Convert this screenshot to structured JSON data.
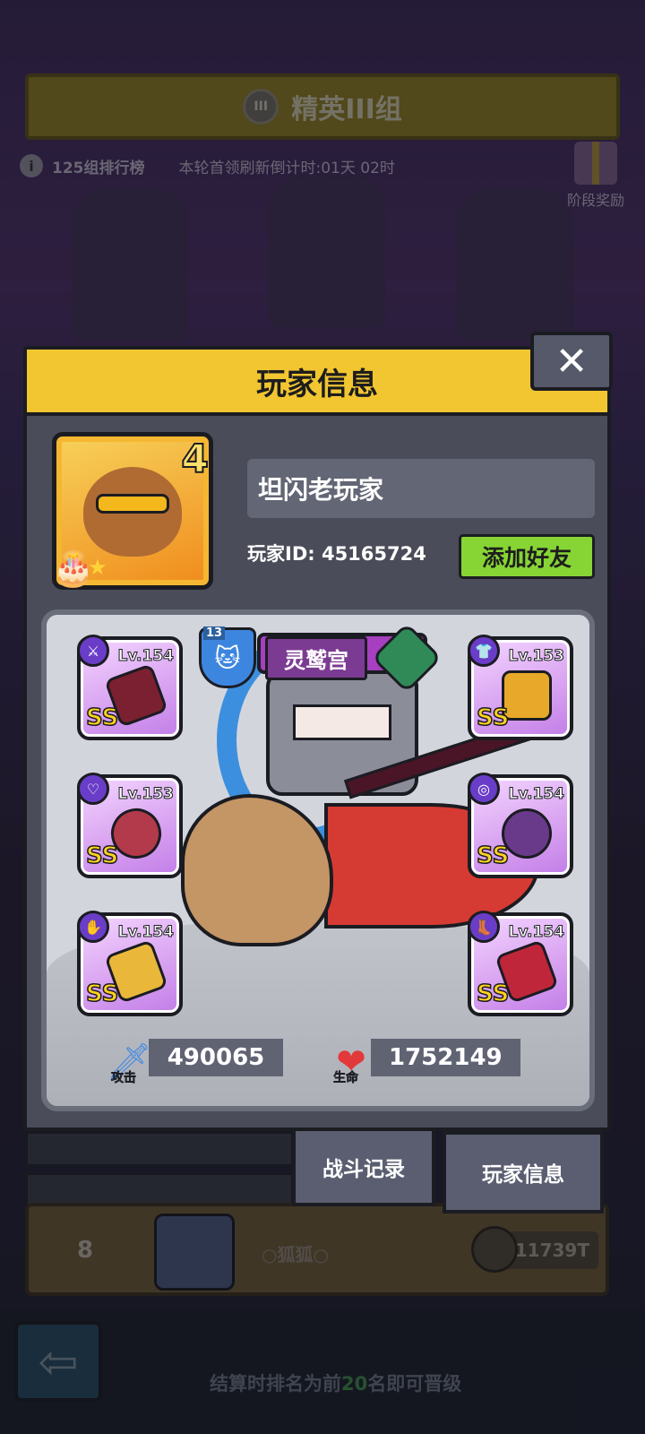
{
  "background": {
    "banner_title": "精英III组",
    "rank_label": "125组排行榜",
    "refresh_text": "本轮首领刷新倒计时:01天 02时",
    "stage_reward": "阶段奖励",
    "emblem_text": "III"
  },
  "dialog": {
    "title": "玩家信息",
    "close": "✕",
    "avatar_level": "4",
    "player_name": "坦闪老玩家",
    "player_id": "玩家ID: 45165724",
    "add_friend": "添加好友",
    "guild": {
      "level": "13",
      "name": "灵鹫宫"
    },
    "equipment": [
      {
        "lv": "Lv.154",
        "grade": "SS",
        "type_icon": "⚔"
      },
      {
        "lv": "Lv.153",
        "grade": "SS",
        "type_icon": "♡"
      },
      {
        "lv": "Lv.154",
        "grade": "SS",
        "type_icon": "✋"
      },
      {
        "lv": "Lv.153",
        "grade": "SS",
        "type_icon": "👕"
      },
      {
        "lv": "Lv.154",
        "grade": "SS",
        "type_icon": "◎"
      },
      {
        "lv": "Lv.154",
        "grade": "SS",
        "type_icon": "👢"
      }
    ],
    "stats": {
      "attack_label": "攻击",
      "attack_value": "490065",
      "hp_label": "生命",
      "hp_value": "1752149"
    }
  },
  "tabs": {
    "battle_record": "战斗记录",
    "player_info": "玩家信息"
  },
  "ranking_row": {
    "rank": "8",
    "name": "○狐狐○",
    "power": "11739T"
  },
  "footer": {
    "promo_prefix": "结算时排名为前",
    "promo_number": "20",
    "promo_suffix": "名即可晋级"
  },
  "colors": {
    "header_yellow": "#f2c631",
    "add_friend_green": "#86d534",
    "slot_purple": "#d7a0f0",
    "guild_blue": "#3d86e0",
    "ss_gold": "#ffd21f"
  }
}
